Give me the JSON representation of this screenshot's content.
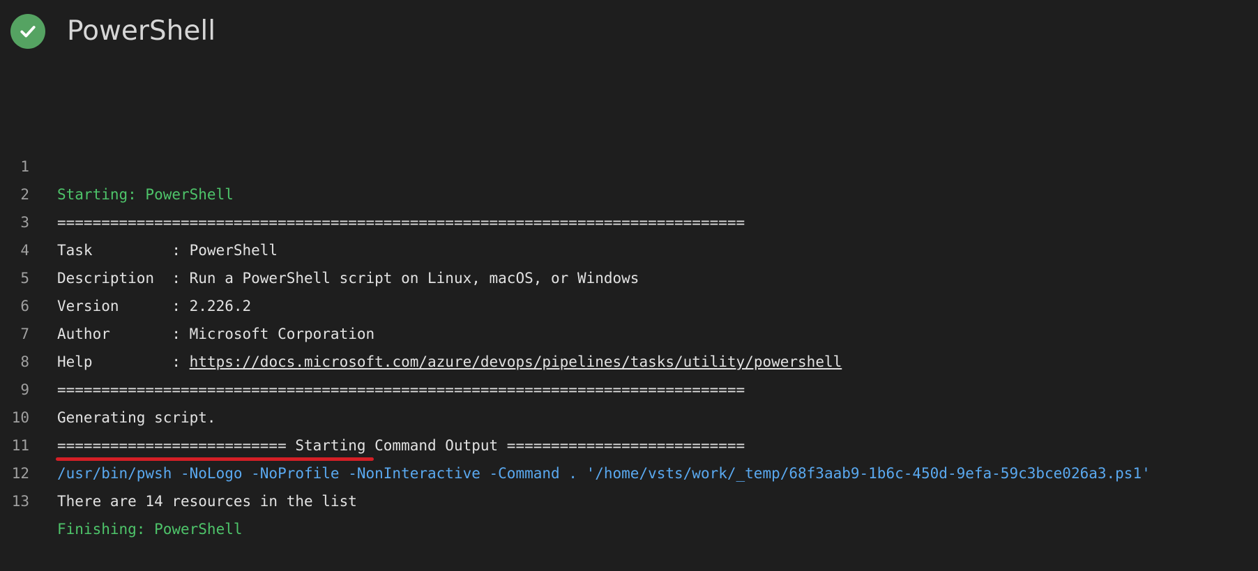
{
  "header": {
    "title": "PowerShell",
    "status_icon": "check-circle-icon",
    "status_color": "#55a362"
  },
  "colors": {
    "background": "#1e1e1e",
    "section_green": "#4ec46a",
    "command_blue": "#5aa9f0",
    "highlight_red": "#d51f26"
  },
  "log": {
    "lines": [
      {
        "number": "1",
        "text": "Starting: PowerShell"
      },
      {
        "number": "2",
        "text": "=============================================================================="
      },
      {
        "number": "3",
        "text": "Task         : PowerShell"
      },
      {
        "number": "4",
        "text": "Description  : Run a PowerShell script on Linux, macOS, or Windows"
      },
      {
        "number": "5",
        "text": "Version      : 2.226.2"
      },
      {
        "number": "6",
        "text": "Author       : Microsoft Corporation"
      },
      {
        "number": "7",
        "text": "Help         : ",
        "link": "https://docs.microsoft.com/azure/devops/pipelines/tasks/utility/powershell"
      },
      {
        "number": "8",
        "text": "=============================================================================="
      },
      {
        "number": "9",
        "text": "Generating script."
      },
      {
        "number": "10",
        "text": "========================== Starting Command Output ==========================="
      },
      {
        "number": "11",
        "text": "/usr/bin/pwsh -NoLogo -NoProfile -NonInteractive -Command . '/home/vsts/work/_temp/68f3aab9-1b6c-450d-9efa-59c3bce026a3.ps1'"
      },
      {
        "number": "12",
        "text": "There are 14 resources in the list"
      },
      {
        "number": "13",
        "text": "Finishing: PowerShell"
      }
    ]
  }
}
